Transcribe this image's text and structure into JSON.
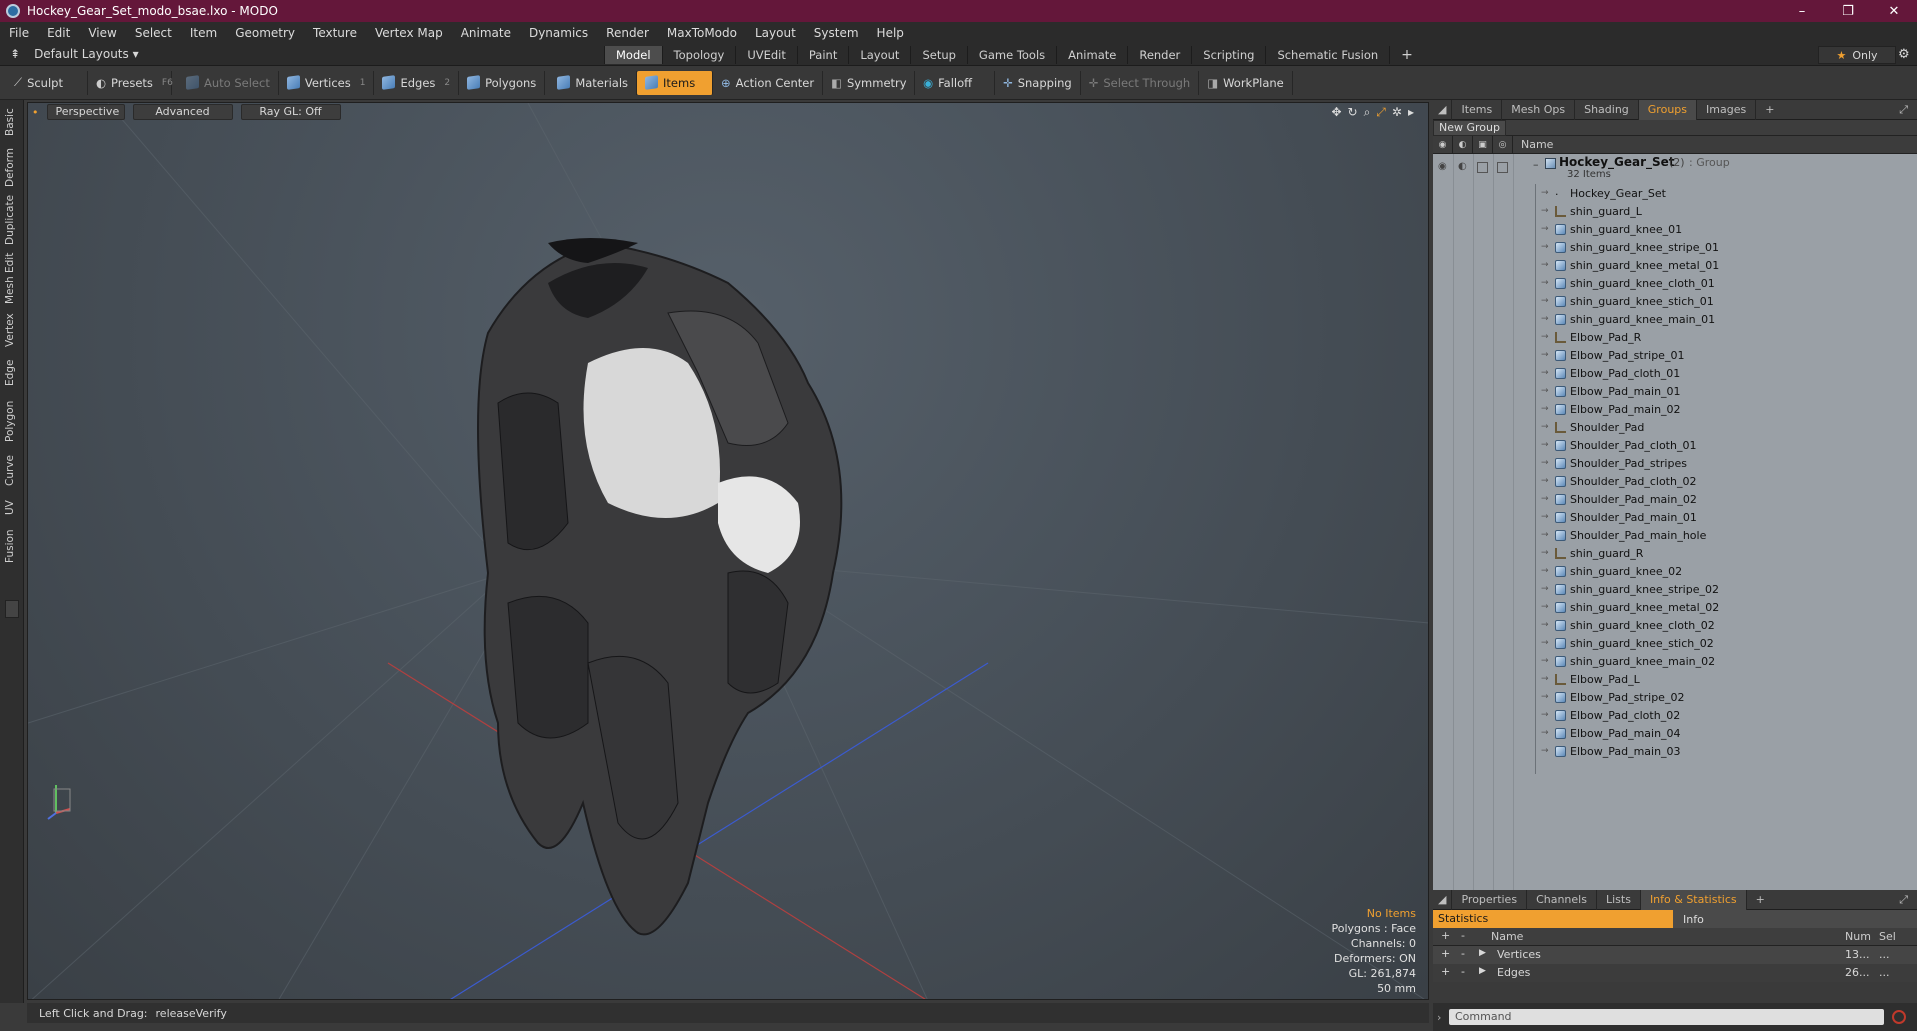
{
  "window": {
    "title": "Hockey_Gear_Set_modo_bsae.lxo - MODO",
    "minimize": "–",
    "maximize": "❐",
    "close": "✕"
  },
  "menu": [
    "File",
    "Edit",
    "View",
    "Select",
    "Item",
    "Geometry",
    "Texture",
    "Vertex Map",
    "Animate",
    "Dynamics",
    "Render",
    "MaxToModo",
    "Layout",
    "System",
    "Help"
  ],
  "modebar": {
    "layouts": "Default Layouts ▾",
    "tabs": [
      "Model",
      "Topology",
      "UVEdit",
      "Paint",
      "Layout",
      "Setup",
      "Game Tools",
      "Animate",
      "Render",
      "Scripting",
      "Schematic Fusion"
    ],
    "active_tab": "Model",
    "add": "+",
    "only": "Only"
  },
  "toolbar": {
    "sculpt": "Sculpt",
    "presets": "Presets",
    "presets_key": "F6",
    "auto_select": "Auto Select",
    "vertices": "Vertices",
    "vertices_n": "1",
    "edges": "Edges",
    "edges_n": "2",
    "polygons": "Polygons",
    "materials": "Materials",
    "items": "Items",
    "action_center": "Action Center",
    "symmetry": "Symmetry",
    "falloff": "Falloff",
    "snapping": "Snapping",
    "select_through": "Select Through",
    "workplane": "WorkPlane"
  },
  "left_tabs": [
    "Basic",
    "Deform",
    "Duplicate",
    "Mesh Edit",
    "Vertex",
    "Edge",
    "Polygon",
    "Curve",
    "UV",
    "Fusion"
  ],
  "viewport": {
    "view": "Perspective",
    "shading": "Advanced",
    "raygl": "Ray GL: Off",
    "info": {
      "items": "No Items",
      "polygons": "Polygons : Face",
      "channels": "Channels: 0",
      "deformers": "Deformers: ON",
      "gl": "GL: 261,874",
      "size": "50 mm"
    }
  },
  "status": {
    "hint": "Left Click and Drag:",
    "action": "releaseVerify"
  },
  "right_panel": {
    "tabs": [
      "Items",
      "Mesh Ops",
      "Shading",
      "Groups",
      "Images"
    ],
    "active_tab": "Groups",
    "add": "+",
    "new_group": "New Group",
    "col_name": "Name",
    "group": {
      "name": "Hockey_Gear_Set",
      "count": "(2)",
      "type": ": Group",
      "items": "32 Items"
    },
    "items": [
      {
        "name": "Hockey_Gear_Set",
        "kind": "null"
      },
      {
        "name": "shin_guard_L",
        "kind": "locator"
      },
      {
        "name": "shin_guard_knee_01",
        "kind": "mesh"
      },
      {
        "name": "shin_guard_knee_stripe_01",
        "kind": "mesh"
      },
      {
        "name": "shin_guard_knee_metal_01",
        "kind": "mesh"
      },
      {
        "name": "shin_guard_knee_cloth_01",
        "kind": "mesh"
      },
      {
        "name": "shin_guard_knee_stich_01",
        "kind": "mesh"
      },
      {
        "name": "shin_guard_knee_main_01",
        "kind": "mesh"
      },
      {
        "name": "Elbow_Pad_R",
        "kind": "locator"
      },
      {
        "name": "Elbow_Pad_stripe_01",
        "kind": "mesh"
      },
      {
        "name": "Elbow_Pad_cloth_01",
        "kind": "mesh"
      },
      {
        "name": "Elbow_Pad_main_01",
        "kind": "mesh"
      },
      {
        "name": "Elbow_Pad_main_02",
        "kind": "mesh"
      },
      {
        "name": "Shoulder_Pad",
        "kind": "locator"
      },
      {
        "name": "Shoulder_Pad_cloth_01",
        "kind": "mesh"
      },
      {
        "name": "Shoulder_Pad_stripes",
        "kind": "mesh"
      },
      {
        "name": "Shoulder_Pad_cloth_02",
        "kind": "mesh"
      },
      {
        "name": "Shoulder_Pad_main_02",
        "kind": "mesh"
      },
      {
        "name": "Shoulder_Pad_main_01",
        "kind": "mesh"
      },
      {
        "name": "Shoulder_Pad_main_hole",
        "kind": "mesh"
      },
      {
        "name": "shin_guard_R",
        "kind": "locator"
      },
      {
        "name": "shin_guard_knee_02",
        "kind": "mesh"
      },
      {
        "name": "shin_guard_knee_stripe_02",
        "kind": "mesh"
      },
      {
        "name": "shin_guard_knee_metal_02",
        "kind": "mesh"
      },
      {
        "name": "shin_guard_knee_cloth_02",
        "kind": "mesh"
      },
      {
        "name": "shin_guard_knee_stich_02",
        "kind": "mesh"
      },
      {
        "name": "shin_guard_knee_main_02",
        "kind": "mesh"
      },
      {
        "name": "Elbow_Pad_L",
        "kind": "locator"
      },
      {
        "name": "Elbow_Pad_stripe_02",
        "kind": "mesh"
      },
      {
        "name": "Elbow_Pad_cloth_02",
        "kind": "mesh"
      },
      {
        "name": "Elbow_Pad_main_04",
        "kind": "mesh"
      },
      {
        "name": "Elbow_Pad_main_03",
        "kind": "mesh"
      }
    ]
  },
  "bottom_panel": {
    "tabs": [
      "Properties",
      "Channels",
      "Lists",
      "Info & Statistics"
    ],
    "active_tab": "Info & Statistics",
    "add": "+",
    "statistics": "Statistics",
    "info": "Info",
    "col_name": "Name",
    "col_num": "Num",
    "col_sel": "Sel",
    "rows": [
      {
        "name": "Vertices",
        "num": "13...",
        "sel": "..."
      },
      {
        "name": "Edges",
        "num": "26...",
        "sel": "..."
      }
    ]
  },
  "command": {
    "placeholder": "Command"
  },
  "colors": {
    "accent": "#f0a030",
    "titlebar": "#64173a"
  }
}
